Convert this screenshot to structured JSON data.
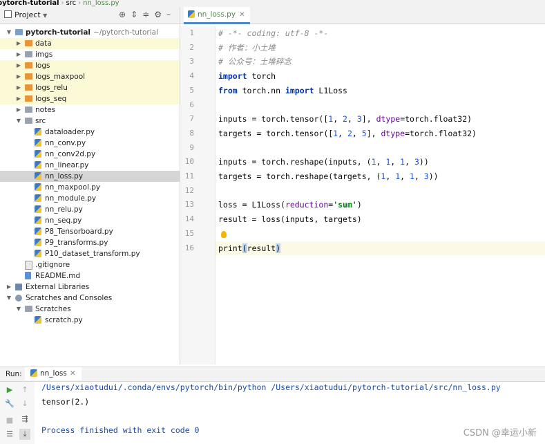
{
  "breadcrumb": {
    "project": "pytorch-tutorial",
    "folder": "src",
    "file": "nn_loss.py"
  },
  "project_panel": {
    "title": "Project",
    "tree": [
      {
        "label": "pytorch-tutorial",
        "suffix": "~/pytorch-tutorial",
        "indent": 0,
        "arrow": "down",
        "icon": "folder-blue",
        "bold": true,
        "highlight": false
      },
      {
        "label": "data",
        "indent": 1,
        "arrow": "right",
        "icon": "folder-orange",
        "highlight": true
      },
      {
        "label": "imgs",
        "indent": 1,
        "arrow": "right",
        "icon": "folder",
        "highlight": false
      },
      {
        "label": "logs",
        "indent": 1,
        "arrow": "right",
        "icon": "folder-orange",
        "highlight": true
      },
      {
        "label": "logs_maxpool",
        "indent": 1,
        "arrow": "right",
        "icon": "folder-orange",
        "highlight": true
      },
      {
        "label": "logs_relu",
        "indent": 1,
        "arrow": "right",
        "icon": "folder-orange",
        "highlight": true
      },
      {
        "label": "logs_seq",
        "indent": 1,
        "arrow": "right",
        "icon": "folder-orange",
        "highlight": true
      },
      {
        "label": "notes",
        "indent": 1,
        "arrow": "right",
        "icon": "folder",
        "highlight": false
      },
      {
        "label": "src",
        "indent": 1,
        "arrow": "down",
        "icon": "folder",
        "highlight": false
      },
      {
        "label": "dataloader.py",
        "indent": 2,
        "icon": "py"
      },
      {
        "label": "nn_conv.py",
        "indent": 2,
        "icon": "py"
      },
      {
        "label": "nn_conv2d.py",
        "indent": 2,
        "icon": "py"
      },
      {
        "label": "nn_linear.py",
        "indent": 2,
        "icon": "py"
      },
      {
        "label": "nn_loss.py",
        "indent": 2,
        "icon": "py",
        "selected": true
      },
      {
        "label": "nn_maxpool.py",
        "indent": 2,
        "icon": "py"
      },
      {
        "label": "nn_module.py",
        "indent": 2,
        "icon": "py"
      },
      {
        "label": "nn_relu.py",
        "indent": 2,
        "icon": "py"
      },
      {
        "label": "nn_seq.py",
        "indent": 2,
        "icon": "py"
      },
      {
        "label": "P8_Tensorboard.py",
        "indent": 2,
        "icon": "py"
      },
      {
        "label": "P9_transforms.py",
        "indent": 2,
        "icon": "py"
      },
      {
        "label": "P10_dataset_transform.py",
        "indent": 2,
        "icon": "py"
      },
      {
        "label": ".gitignore",
        "indent": 1,
        "icon": "file"
      },
      {
        "label": "README.md",
        "indent": 1,
        "icon": "md"
      },
      {
        "label": "External Libraries",
        "indent": 0,
        "arrow": "right",
        "icon": "lib"
      },
      {
        "label": "Scratches and Consoles",
        "indent": 0,
        "arrow": "down",
        "icon": "scratch"
      },
      {
        "label": "Scratches",
        "indent": 1,
        "arrow": "down",
        "icon": "folder"
      },
      {
        "label": "scratch.py",
        "indent": 2,
        "icon": "py"
      }
    ]
  },
  "editor": {
    "tab_label": "nn_loss.py",
    "current_line": 16,
    "lines": [
      "# -*- coding: utf-8 -*-",
      "# 作者：小土堆",
      "# 公众号：土堆碎念",
      "import torch",
      "from torch.nn import L1Loss",
      "",
      "inputs = torch.tensor([1, 2, 3], dtype=torch.float32)",
      "targets = torch.tensor([1, 2, 5], dtype=torch.float32)",
      "",
      "inputs = torch.reshape(inputs, (1, 1, 1, 3))",
      "targets = torch.reshape(targets, (1, 1, 1, 3))",
      "",
      "loss = L1Loss(reduction='sum')",
      "result = loss(inputs, targets)",
      "",
      "print(result)"
    ]
  },
  "run_panel": {
    "label": "Run:",
    "tab_label": "nn_loss",
    "output": [
      "/Users/xiaotudui/.conda/envs/pytorch/bin/python /Users/xiaotudui/pytorch-tutorial/src/nn_loss.py",
      "tensor(2.)",
      "",
      "Process finished with exit code 0"
    ]
  },
  "watermark": "CSDN @幸运小新"
}
